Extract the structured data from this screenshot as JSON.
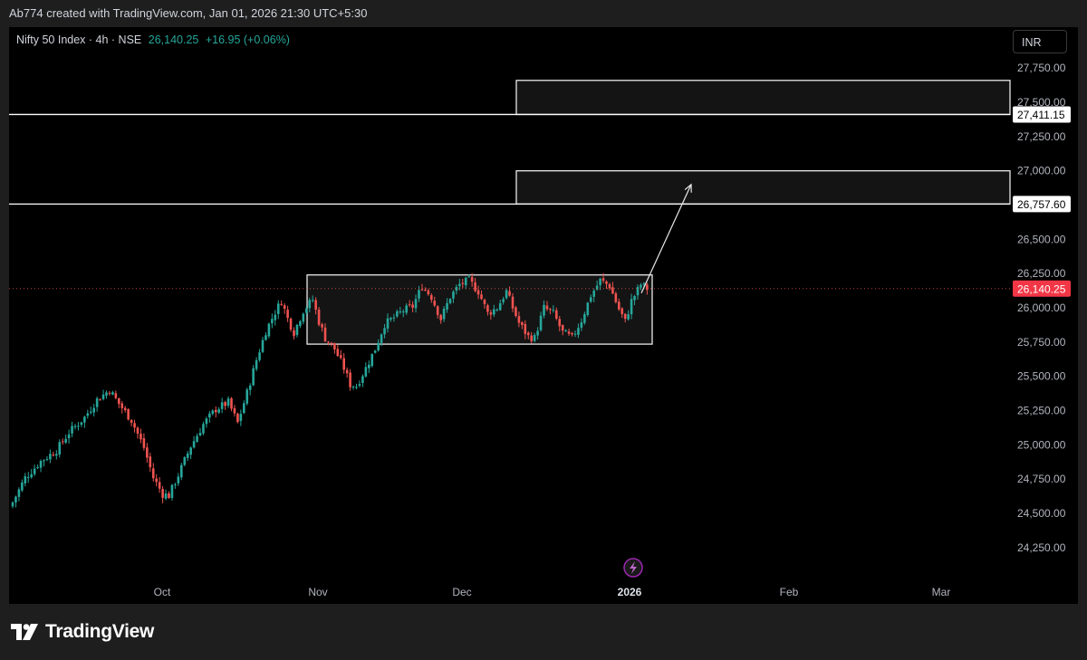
{
  "header": {
    "attribution": "Ab774 created with TradingView.com, Jan 01, 2026 21:30 UTC+5:30"
  },
  "legend": {
    "symbol": "Nifty 50 Index · 4h · NSE",
    "price": "26,140.25",
    "change": "+16.95 (+0.06%)"
  },
  "currency": "INR",
  "brand": "TradingView",
  "colors": {
    "up": "#26a69a",
    "down": "#ef5350",
    "current_price_label": "#f23645",
    "level_label_bg": "#ffffff"
  },
  "chart_data": {
    "type": "candlestick",
    "title": "Nifty 50 Index · 4h · NSE",
    "x_ticks": [
      "Oct",
      "Nov",
      "Dec",
      "2026",
      "Feb",
      "Mar"
    ],
    "y_ticks": [
      "27,750.00",
      "27,500.00",
      "27,250.00",
      "27,000.00",
      "26,500.00",
      "26,250.00",
      "26,000.00",
      "25,750.00",
      "25,500.00",
      "25,250.00",
      "25,000.00",
      "24,750.00",
      "24,500.00",
      "24,250.00"
    ],
    "ylim": [
      24100,
      27950
    ],
    "price_labels": [
      {
        "text": "27,411.15",
        "value": 27411.15,
        "style": "white"
      },
      {
        "text": "26,757.60",
        "value": 26757.6,
        "style": "white"
      },
      {
        "text": "26,140.25",
        "value": 26140.25,
        "style": "red"
      }
    ],
    "horizontal_lines": [
      27411.15,
      26757.6
    ],
    "current_price": 26140.25,
    "zones": [
      {
        "name": "upper-target-zone",
        "top": 27660,
        "bottom": 27411.15
      },
      {
        "name": "lower-target-zone",
        "top": 27000,
        "bottom": 26757.6
      },
      {
        "name": "consolidation-range",
        "top": 26240,
        "bottom": 25735
      }
    ],
    "path_points": [
      {
        "t": 0,
        "v": 24580
      },
      {
        "t": 4,
        "v": 24760
      },
      {
        "t": 9,
        "v": 24880
      },
      {
        "t": 14,
        "v": 24960
      },
      {
        "t": 18,
        "v": 25090
      },
      {
        "t": 23,
        "v": 25200
      },
      {
        "t": 27,
        "v": 25330
      },
      {
        "t": 31,
        "v": 25400
      },
      {
        "t": 34,
        "v": 25300
      },
      {
        "t": 38,
        "v": 25180
      },
      {
        "t": 42,
        "v": 24980
      },
      {
        "t": 45,
        "v": 24760
      },
      {
        "t": 48,
        "v": 24640
      },
      {
        "t": 50,
        "v": 24630
      },
      {
        "t": 53,
        "v": 24780
      },
      {
        "t": 57,
        "v": 24990
      },
      {
        "t": 61,
        "v": 25150
      },
      {
        "t": 65,
        "v": 25260
      },
      {
        "t": 69,
        "v": 25310
      },
      {
        "t": 72,
        "v": 25160
      },
      {
        "t": 75,
        "v": 25380
      },
      {
        "t": 78,
        "v": 25620
      },
      {
        "t": 81,
        "v": 25830
      },
      {
        "t": 84,
        "v": 25970
      },
      {
        "t": 86,
        "v": 26050
      },
      {
        "t": 88,
        "v": 25920
      },
      {
        "t": 90,
        "v": 25820
      },
      {
        "t": 93,
        "v": 25980
      },
      {
        "t": 96,
        "v": 26060
      },
      {
        "t": 98,
        "v": 25900
      },
      {
        "t": 100,
        "v": 25780
      },
      {
        "t": 103,
        "v": 25700
      },
      {
        "t": 106,
        "v": 25560
      },
      {
        "t": 108,
        "v": 25440
      },
      {
        "t": 110,
        "v": 25430
      },
      {
        "t": 113,
        "v": 25560
      },
      {
        "t": 116,
        "v": 25700
      },
      {
        "t": 119,
        "v": 25880
      },
      {
        "t": 122,
        "v": 25930
      },
      {
        "t": 125,
        "v": 25980
      },
      {
        "t": 128,
        "v": 26010
      },
      {
        "t": 131,
        "v": 26160
      },
      {
        "t": 134,
        "v": 26080
      },
      {
        "t": 137,
        "v": 25920
      },
      {
        "t": 140,
        "v": 26080
      },
      {
        "t": 143,
        "v": 26170
      },
      {
        "t": 146,
        "v": 26200
      },
      {
        "t": 149,
        "v": 26120
      },
      {
        "t": 152,
        "v": 25960
      },
      {
        "t": 155,
        "v": 26000
      },
      {
        "t": 158,
        "v": 26120
      },
      {
        "t": 160,
        "v": 26000
      },
      {
        "t": 162,
        "v": 25890
      },
      {
        "t": 165,
        "v": 25790
      },
      {
        "t": 167,
        "v": 25780
      },
      {
        "t": 170,
        "v": 26000
      },
      {
        "t": 173,
        "v": 25960
      },
      {
        "t": 176,
        "v": 25820
      },
      {
        "t": 179,
        "v": 25780
      },
      {
        "t": 182,
        "v": 25910
      },
      {
        "t": 185,
        "v": 26090
      },
      {
        "t": 188,
        "v": 26200
      },
      {
        "t": 191,
        "v": 26160
      },
      {
        "t": 194,
        "v": 25990
      },
      {
        "t": 196,
        "v": 25900
      },
      {
        "t": 198,
        "v": 26050
      },
      {
        "t": 201,
        "v": 26170
      },
      {
        "t": 203,
        "v": 26140
      }
    ],
    "projection": {
      "from": 26140.25,
      "to": 26900
    }
  }
}
